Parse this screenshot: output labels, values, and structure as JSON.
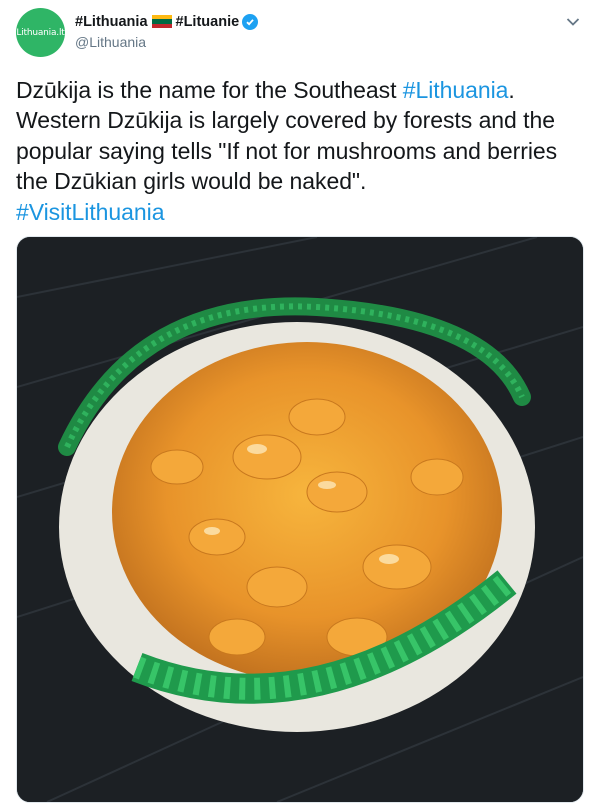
{
  "account": {
    "display_name_1": "#Lithuania",
    "display_name_2": "#Lituanie",
    "handle": "@Lithuania",
    "avatar_text": "Lithuania.lt"
  },
  "icons": {
    "flag": "lithuania-flag-icon",
    "verified": "verified-badge-icon",
    "more": "chevron-down-icon"
  },
  "tweet": {
    "line1": "Dzūkija is the name for the Southeast ",
    "hashtag1": "#Lithuania",
    "line1_end": ".",
    "line2": "Western Dzūkija is largely covered by forests and the",
    "line3": "popular saying tells \"If not for mushrooms and berries",
    "line4": "the Dzūkian girls would be naked\".",
    "hashtag2": "#VisitLithuania"
  },
  "colors": {
    "link": "#1b95e0",
    "avatar_bg": "#2fb566",
    "verified": "#1da1f2"
  }
}
